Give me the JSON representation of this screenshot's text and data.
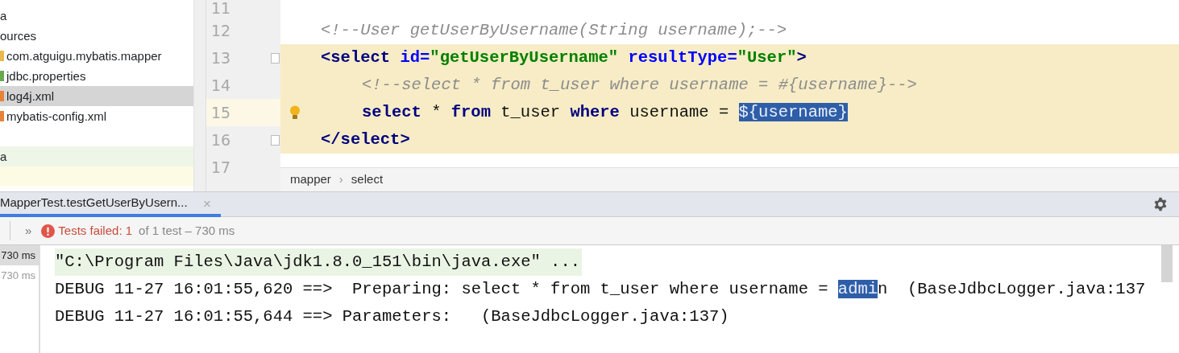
{
  "project_tree": {
    "items": [
      {
        "label": "a",
        "selected": false
      },
      {
        "label": "ources",
        "selected": false
      },
      {
        "label": "com.atguigu.mybatis.mapper",
        "selected": false,
        "kind": "folder"
      },
      {
        "label": "jdbc.properties",
        "selected": false,
        "kind": "file"
      },
      {
        "label": "log4j.xml",
        "selected": true,
        "kind": "xml"
      },
      {
        "label": "mybatis-config.xml",
        "selected": false,
        "kind": "xml"
      },
      {
        "selected": false
      },
      {
        "label": "a",
        "selected": false,
        "color": "#eef6e8"
      },
      {
        "selected": false,
        "color": "#fdfbe4"
      }
    ]
  },
  "editor": {
    "lines": [
      {
        "number": "11",
        "highlighted": false,
        "current": false
      },
      {
        "number": "12",
        "highlighted": false,
        "current": false,
        "indented": false,
        "segments": [
          {
            "kind": "comment",
            "text": "<!--User getUserByUsername(String username);-->"
          }
        ]
      },
      {
        "number": "13",
        "highlighted": true,
        "current": false,
        "indented": false,
        "fold": true,
        "segments": [
          {
            "kind": "tag",
            "text": "<select "
          },
          {
            "kind": "attr",
            "text": "id="
          },
          {
            "kind": "string",
            "text": "\"getUserByUsername\" "
          },
          {
            "kind": "attr",
            "text": "resultType="
          },
          {
            "kind": "string",
            "text": "\"User\""
          },
          {
            "kind": "tag",
            "text": ">"
          }
        ]
      },
      {
        "number": "14",
        "highlighted": true,
        "current": false,
        "indented": true,
        "segments": [
          {
            "kind": "comment",
            "text": "<!--select * from t_user where username = #{username}-->"
          }
        ]
      },
      {
        "number": "15",
        "highlighted": true,
        "current": true,
        "indented": true,
        "bulb": true,
        "segments": [
          {
            "kind": "keyword",
            "text": "select "
          },
          {
            "kind": "plain",
            "text": "* "
          },
          {
            "kind": "keyword",
            "text": "from "
          },
          {
            "kind": "plain",
            "text": "t_user "
          },
          {
            "kind": "keyword",
            "text": "where "
          },
          {
            "kind": "plain",
            "text": "username = "
          },
          {
            "kind": "selected",
            "text": "${username}"
          }
        ]
      },
      {
        "number": "16",
        "highlighted": true,
        "current": false,
        "indented": false,
        "fold": true,
        "segments": [
          {
            "kind": "tag",
            "text": "</select>"
          }
        ]
      },
      {
        "number": "17",
        "highlighted": false,
        "current": false
      }
    ],
    "breadcrumb": [
      "mapper",
      "select"
    ],
    "breadcrumb_separator": "›"
  },
  "run_panel": {
    "tabs": [
      {
        "label": "MapperTest.testGetUserByUsern...",
        "selected": true,
        "close": "×"
      }
    ],
    "toolbar": {
      "expander": "»",
      "status": "Tests failed: 1",
      "detail": "of 1 test – 730 ms"
    },
    "tests": [
      {
        "time": "730 ms",
        "selected": true
      },
      {
        "time": "730 ms",
        "selected": false
      }
    ],
    "console": [
      {
        "kind": "command",
        "segments": [
          {
            "kind": "plain",
            "text": "\"C:\\Program Files\\Java\\jdk1.8.0_151\\bin\\java.exe\" ..."
          }
        ]
      },
      {
        "kind": "log",
        "segments": [
          {
            "kind": "plain",
            "text": "DEBUG 11-27 16:01:55,620 ==>  Preparing: select * from t_user where username = "
          },
          {
            "kind": "selected",
            "text": "admi"
          },
          {
            "kind": "plain",
            "text": "n  (BaseJdbcLogger.java:137"
          }
        ]
      },
      {
        "kind": "log",
        "segments": [
          {
            "kind": "plain",
            "text": "DEBUG 11-27 16:01:55,644 ==> Parameters:   (BaseJdbcLogger.java:137)"
          }
        ]
      }
    ]
  }
}
